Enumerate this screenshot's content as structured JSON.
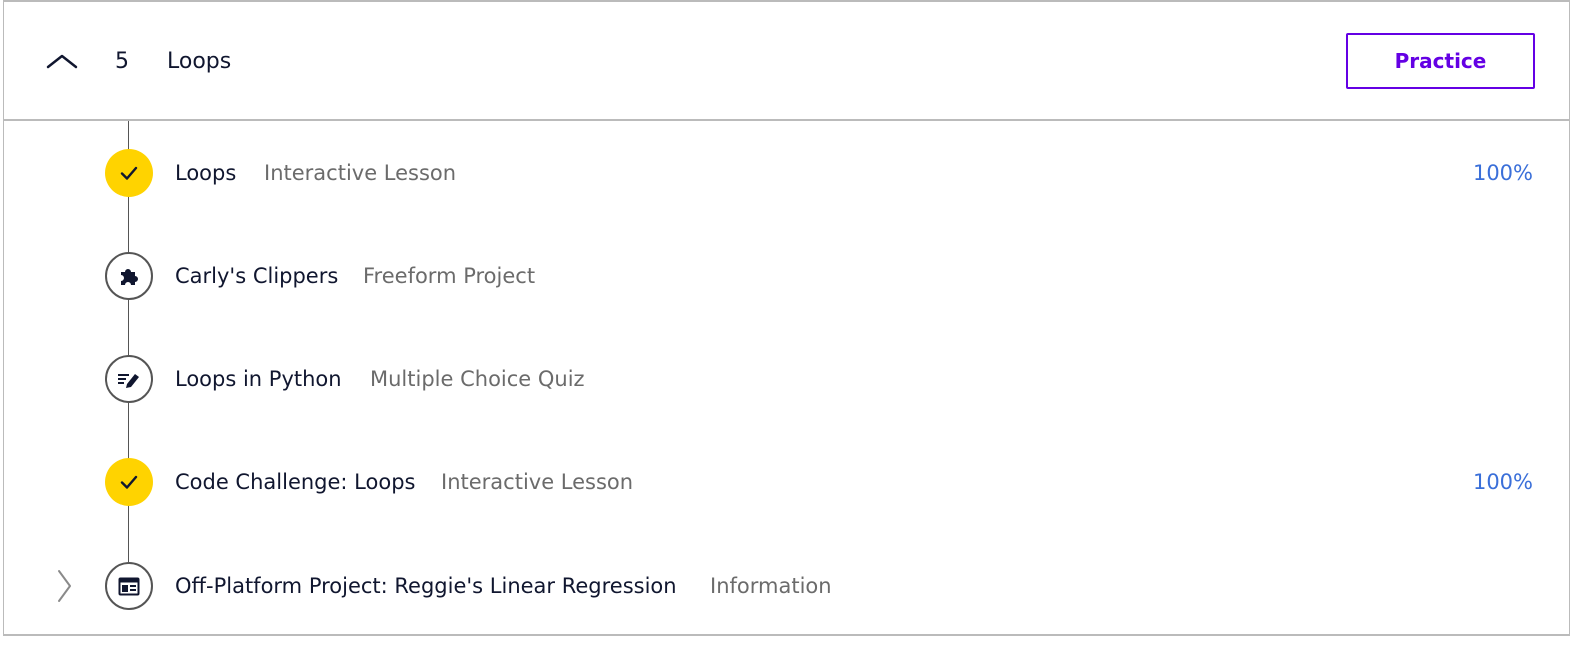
{
  "module": {
    "number": "5",
    "title": "Loops",
    "collapse_icon": "chevron-up-icon",
    "practice_label": "Practice",
    "accent_color": "#6400e4"
  },
  "lessons": [
    {
      "name": "Loops",
      "type": "Interactive Lesson",
      "progress": "100%",
      "status": "complete",
      "icon": "checkmark-icon"
    },
    {
      "name": "Carly's Clippers",
      "type": "Freeform Project",
      "progress": "",
      "status": "incomplete",
      "icon": "puzzle-piece-icon"
    },
    {
      "name": "Loops in Python",
      "type": "Multiple Choice Quiz",
      "progress": "",
      "status": "incomplete",
      "icon": "quiz-pencil-icon"
    },
    {
      "name": "Code Challenge: Loops",
      "type": "Interactive Lesson",
      "progress": "100%",
      "status": "complete",
      "icon": "checkmark-icon"
    },
    {
      "name": "Off-Platform Project: Reggie's Linear Regression",
      "type": "Information",
      "progress": "",
      "status": "incomplete",
      "icon": "article-icon",
      "expand_icon": "chevron-right-icon"
    }
  ],
  "colors": {
    "complete_badge": "#ffd300",
    "progress_text": "#3a6fd9",
    "secondary_text": "#6b6b6b",
    "primary_text": "#10162f"
  }
}
